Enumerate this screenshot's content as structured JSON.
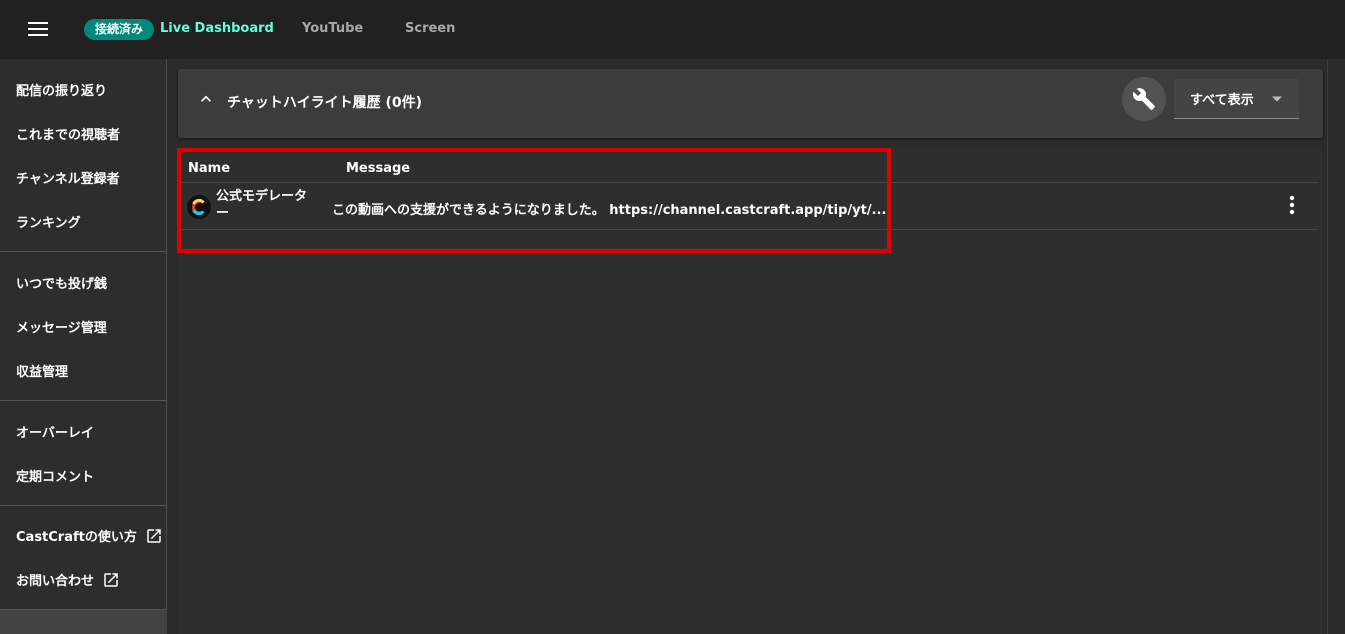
{
  "topbar": {
    "status_badge": "接続済み",
    "tabs": [
      {
        "label": "Live Dashboard",
        "active": true
      },
      {
        "label": "YouTube",
        "active": false
      },
      {
        "label": "Screen",
        "active": false
      }
    ]
  },
  "sidebar": {
    "groups": [
      [
        "配信の振り返り",
        "これまでの視聴者",
        "チャンネル登録者",
        "ランキング"
      ],
      [
        "いつでも投げ銭",
        "メッセージ管理",
        "収益管理"
      ],
      [
        "オーバーレイ",
        "定期コメント"
      ],
      [
        "CastCraftの使い方",
        "お問い合わせ"
      ]
    ]
  },
  "panel": {
    "title": "チャットハイライト履歴 (0件)",
    "filter_value": "すべて表示"
  },
  "table": {
    "columns": [
      "Name",
      "Message"
    ],
    "rows": [
      {
        "name": "公式モデレーター",
        "message": "この動画への支援ができるようになりました。 https://channel.castcraft.app/tip/yt/..."
      }
    ]
  },
  "colors": {
    "accent": "#64ffda",
    "badge": "#00897b",
    "highlight": "#e00000"
  },
  "icons": [
    "menu-icon",
    "chevron-up-icon",
    "wrench-icon",
    "caret-down-icon",
    "external-link-icon",
    "more-vert-icon"
  ]
}
